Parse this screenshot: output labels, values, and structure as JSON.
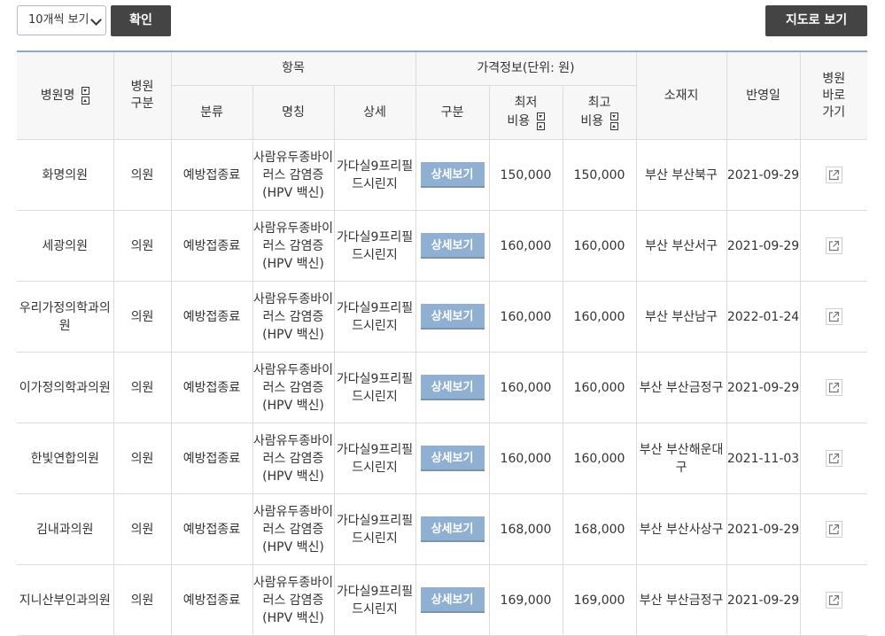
{
  "controls": {
    "page_size": "10개씩 보기",
    "confirm_label": "확인",
    "map_label": "지도로 보기"
  },
  "table": {
    "headers": {
      "hospital_name": "병원명",
      "hospital_type": "병원\n구분",
      "item": "항목",
      "price_info": "가격정보(단위: 원)",
      "location": "소재지",
      "updated": "반영일",
      "goto": "병원\n바로\n가기",
      "category": "분류",
      "name": "명칭",
      "detail": "상세",
      "division": "구분",
      "min_cost": "최저\n비용",
      "max_cost": "최고\n비용"
    },
    "detail_button_label": "상세보기",
    "rows": [
      {
        "name": "화명의원",
        "type": "의원",
        "category": "예방접종료",
        "item_name": "사람유두종바이러스 감염증(HPV 백신)",
        "detail": "가다실9프리필드시린지",
        "min": "150,000",
        "max": "150,000",
        "location": "부산 부산북구",
        "date": "2021-09-29"
      },
      {
        "name": "세광의원",
        "type": "의원",
        "category": "예방접종료",
        "item_name": "사람유두종바이러스 감염증(HPV 백신)",
        "detail": "가다실9프리필드시린지",
        "min": "160,000",
        "max": "160,000",
        "location": "부산 부산서구",
        "date": "2021-09-29"
      },
      {
        "name": "우리가정의학과의원",
        "type": "의원",
        "category": "예방접종료",
        "item_name": "사람유두종바이러스 감염증(HPV 백신)",
        "detail": "가다실9프리필드시린지",
        "min": "160,000",
        "max": "160,000",
        "location": "부산 부산남구",
        "date": "2022-01-24"
      },
      {
        "name": "이가정의학과의원",
        "type": "의원",
        "category": "예방접종료",
        "item_name": "사람유두종바이러스 감염증(HPV 백신)",
        "detail": "가다실9프리필드시린지",
        "min": "160,000",
        "max": "160,000",
        "location": "부산 부산금정구",
        "date": "2021-09-29"
      },
      {
        "name": "한빛연합의원",
        "type": "의원",
        "category": "예방접종료",
        "item_name": "사람유두종바이러스 감염증(HPV 백신)",
        "detail": "가다실9프리필드시린지",
        "min": "160,000",
        "max": "160,000",
        "location": "부산 부산해운대구",
        "date": "2021-11-03"
      },
      {
        "name": "김내과의원",
        "type": "의원",
        "category": "예방접종료",
        "item_name": "사람유두종바이러스 감염증(HPV 백신)",
        "detail": "가다실9프리필드시린지",
        "min": "168,000",
        "max": "168,000",
        "location": "부산 부산사상구",
        "date": "2021-09-29"
      },
      {
        "name": "지니산부인과의원",
        "type": "의원",
        "category": "예방접종료",
        "item_name": "사람유두종바이러스 감염증(HPV 백신)",
        "detail": "가다실9프리필드시린지",
        "min": "169,000",
        "max": "169,000",
        "location": "부산 부산금정구",
        "date": "2021-09-29"
      }
    ]
  }
}
